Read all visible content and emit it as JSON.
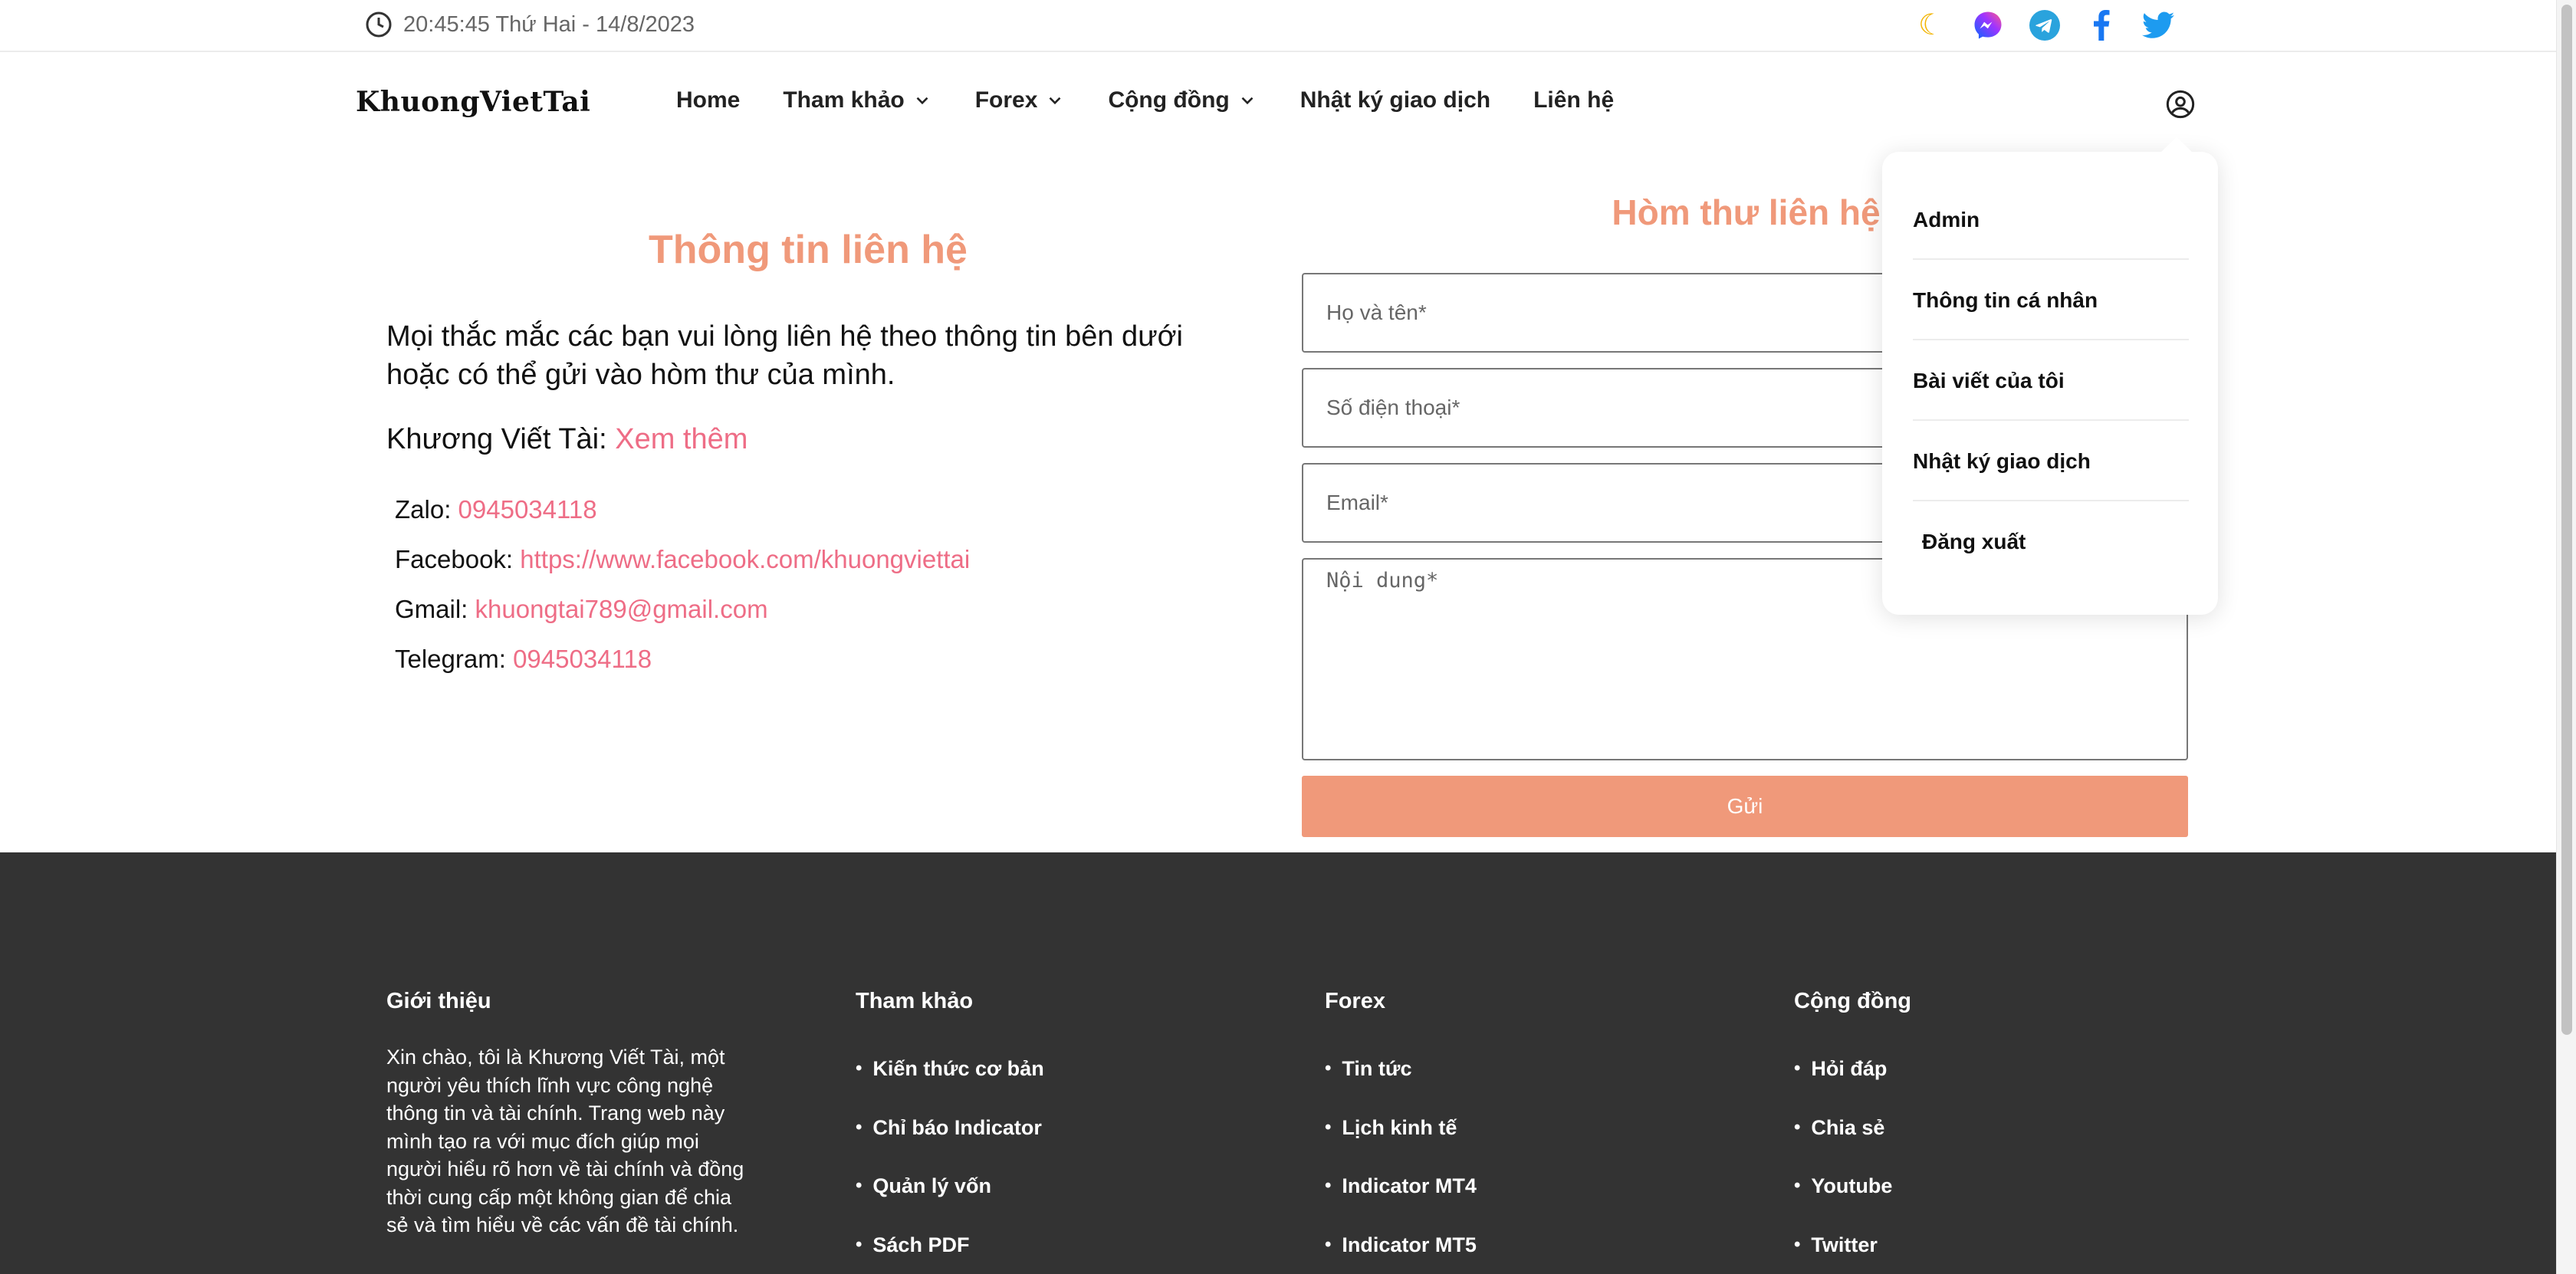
{
  "topbar": {
    "datetime": "20:45:45 Thứ Hai - 14/8/2023",
    "icons": [
      "clock-icon",
      "moon-icon",
      "messenger-icon",
      "telegram-icon",
      "facebook-icon",
      "twitter-icon"
    ]
  },
  "nav": {
    "logo": "KhuongVietTai",
    "items": [
      {
        "label": "Home",
        "dropdown": false
      },
      {
        "label": "Tham khảo",
        "dropdown": true
      },
      {
        "label": "Forex",
        "dropdown": true
      },
      {
        "label": "Cộng đồng",
        "dropdown": true
      },
      {
        "label": "Nhật ký giao dịch",
        "dropdown": false
      },
      {
        "label": "Liên hệ",
        "dropdown": false
      }
    ]
  },
  "contact_info": {
    "title": "Thông tin liên hệ",
    "intro": "Mọi thắc mắc các bạn vui lòng liên hệ theo thông tin bên dưới hoặc có thể gửi vào hòm thư của mình.",
    "author_label": "Khương Viết Tài:",
    "author_link": "Xem thêm",
    "items": [
      {
        "label": "Zalo:",
        "value": "0945034118"
      },
      {
        "label": "Facebook:",
        "value": "https://www.facebook.com/khuongviettai"
      },
      {
        "label": "Gmail:",
        "value": "khuongtai789@gmail.com"
      },
      {
        "label": "Telegram:",
        "value": "0945034118"
      }
    ]
  },
  "mail_form": {
    "title": "Hòm thư liên hệ",
    "name_placeholder": "Họ và tên*",
    "phone_placeholder": "Số điện thoại*",
    "email_placeholder": "Email*",
    "content_placeholder": "Nội dung*",
    "submit_label": "Gửi"
  },
  "user_menu": {
    "items": [
      "Admin",
      "Thông tin cá nhân",
      "Bài viết của tôi",
      "Nhật ký giao dịch",
      "Đăng xuất"
    ]
  },
  "footer": {
    "about_title": "Giới thiệu",
    "about_text": "Xin chào, tôi là Khương Viết Tài, một người yêu thích lĩnh vực công nghệ thông tin và tài chính. Trang web này mình tạo ra với mục đích giúp mọi người hiểu rõ hơn về tài chính và đồng thời cung cấp một không gian để chia sẻ và tìm hiểu về các vấn đề tài chính.",
    "columns": [
      {
        "title": "Tham khảo",
        "links": [
          "Kiến thức cơ bản",
          "Chỉ báo Indicator",
          "Quản lý vốn",
          "Sách PDF"
        ]
      },
      {
        "title": "Forex",
        "links": [
          "Tin tức",
          "Lịch kinh tế",
          "Indicator MT4",
          "Indicator MT5"
        ]
      },
      {
        "title": "Cộng đồng",
        "links": [
          "Hỏi đáp",
          "Chia sẻ",
          "Youtube",
          "Twitter"
        ]
      }
    ]
  }
}
